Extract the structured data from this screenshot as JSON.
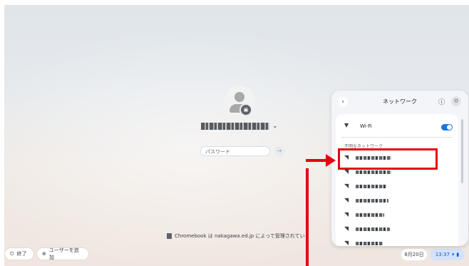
{
  "login": {
    "password_placeholder": "パスワード",
    "submit_glyph": "→",
    "user_menu_glyph": "⌄"
  },
  "managed_notice": "Chromebook は nakagawa.ed.jp によって管理されてい",
  "shelf": {
    "shutdown_label": "終了",
    "add_user_label": "ユーザーを追加",
    "date": "8月20日",
    "time": "13:37"
  },
  "network_panel": {
    "title": "ネットワーク",
    "back_glyph": "‹",
    "info_glyph": "ⓘ",
    "settings_glyph": "⚙",
    "wifi_label": "Wi-Fi",
    "wifi_enabled": true,
    "unknown_networks_label": "不明なネットワーク",
    "network_count_visible": 7
  },
  "colors": {
    "accent": "#1a73e8",
    "annotation": "#e60012"
  }
}
